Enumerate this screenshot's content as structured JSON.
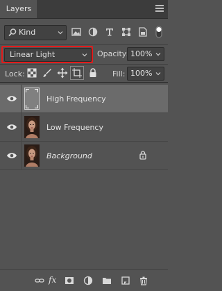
{
  "panel": {
    "tab_label": "Layers"
  },
  "filter": {
    "kind_label": "Kind"
  },
  "blend": {
    "mode": "Linear Light",
    "opacity_label": "Opacity:",
    "opacity_value": "100%"
  },
  "lock": {
    "label": "Lock:",
    "fill_label": "Fill:",
    "fill_value": "100%"
  },
  "layers": [
    {
      "name": "High Frequency",
      "selected": true,
      "visible": true,
      "italic": false,
      "thumbnail": "gray"
    },
    {
      "name": "Low Frequency",
      "selected": false,
      "visible": true,
      "italic": false,
      "thumbnail": "portrait"
    },
    {
      "name": "Background",
      "selected": false,
      "visible": true,
      "italic": true,
      "locked": true,
      "thumbnail": "portrait"
    }
  ],
  "bottom_icons": [
    "link-icon",
    "fx-icon",
    "mask-icon",
    "adjustment-icon",
    "folder-icon",
    "new-layer-icon",
    "trash-icon"
  ],
  "bottom": {
    "fx_label": "fx"
  },
  "colors": {
    "panel_bg": "#535353",
    "selected_row": "#6b6b6b",
    "highlight_border": "#e21b1b"
  }
}
